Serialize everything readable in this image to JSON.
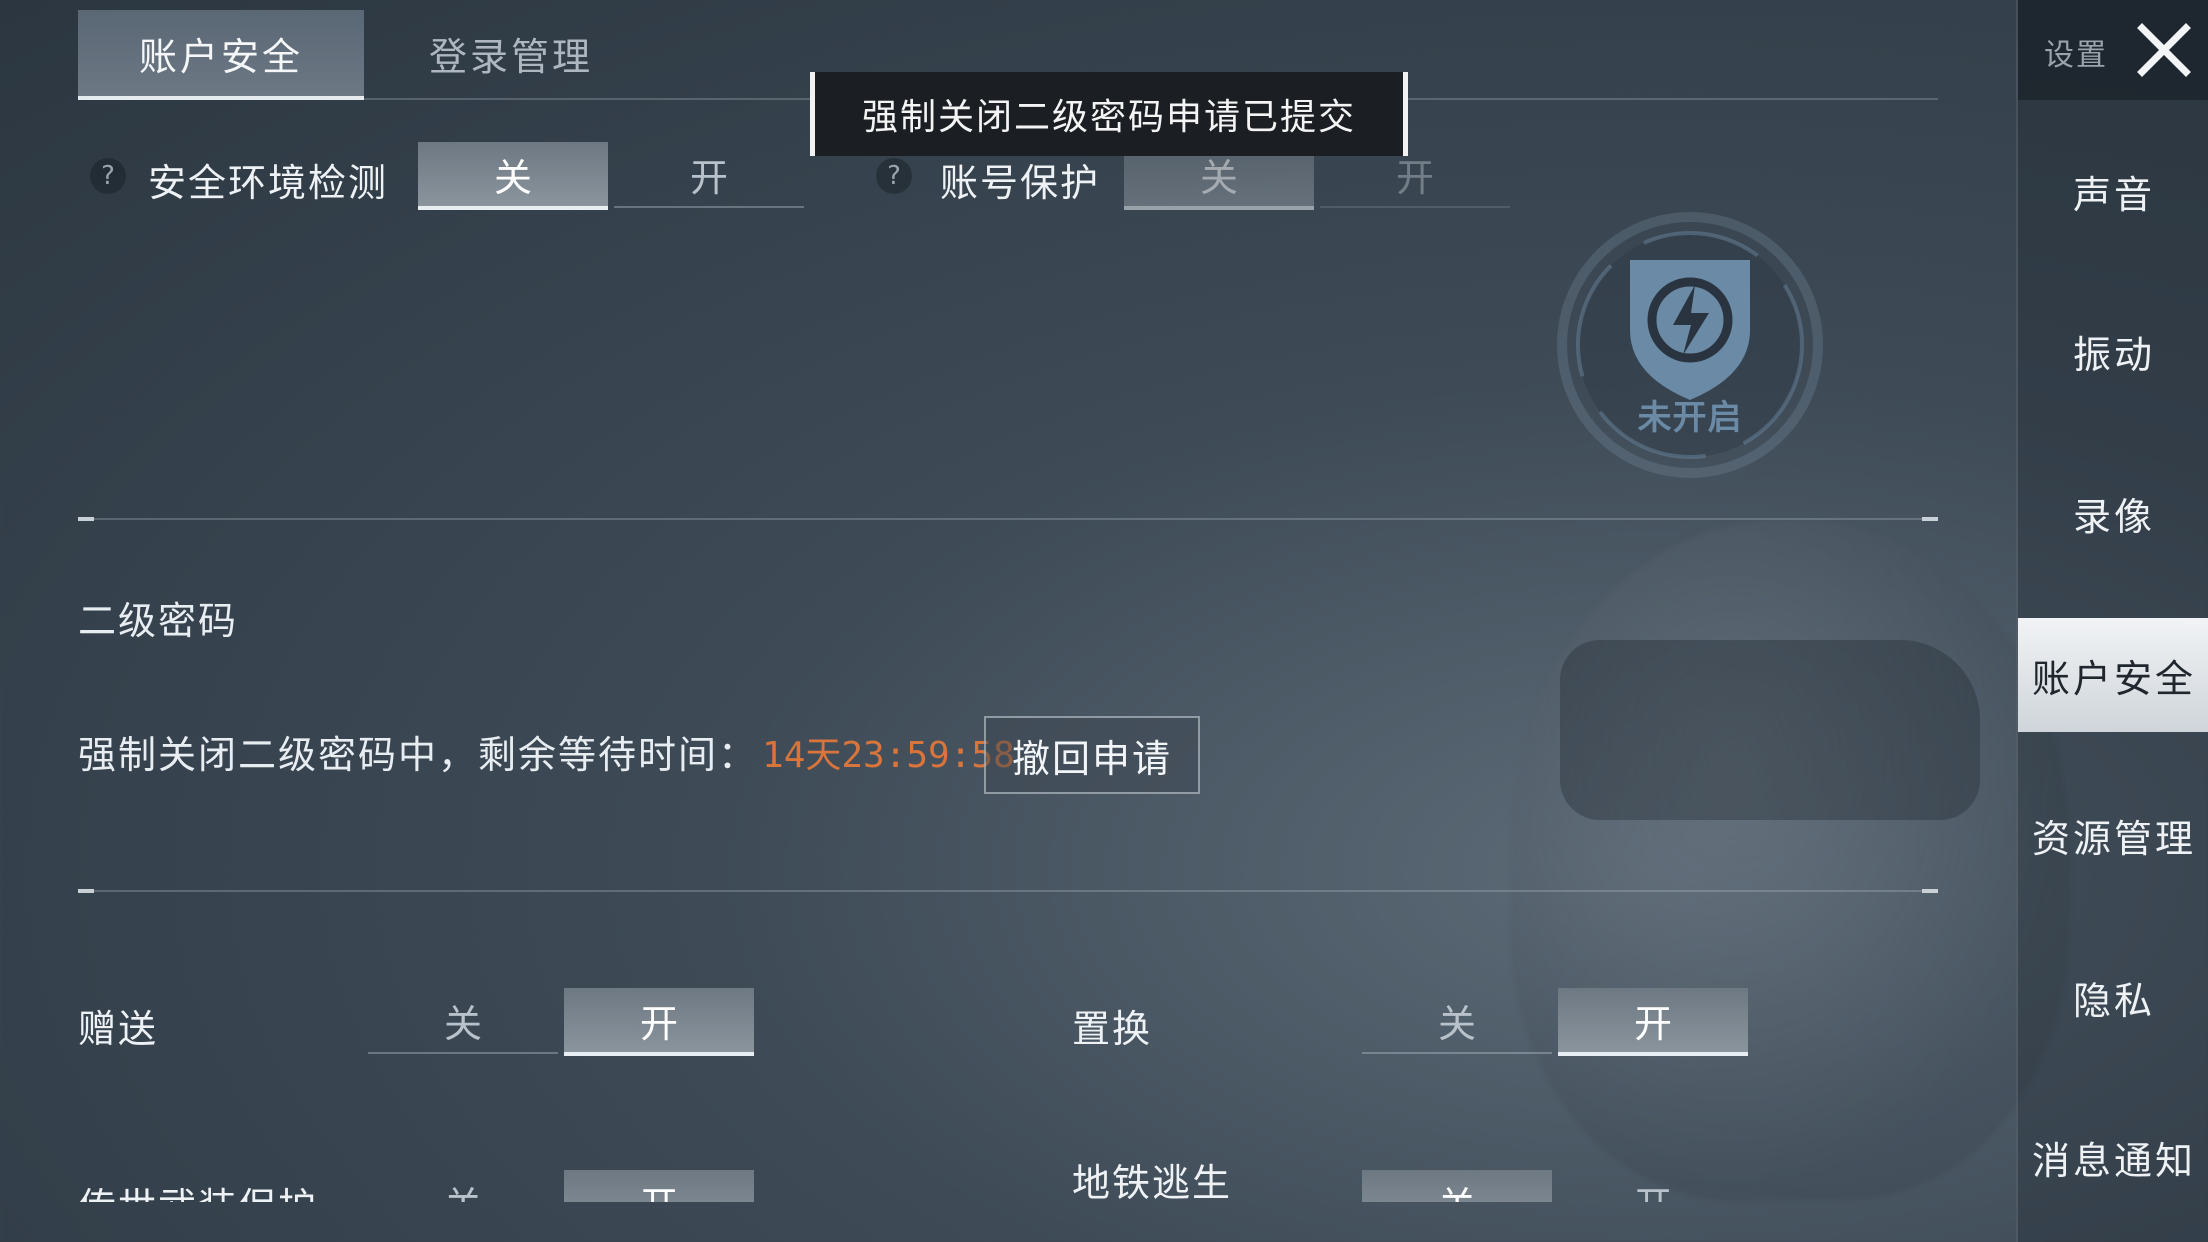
{
  "tabs": [
    {
      "label": "账户安全",
      "active": true
    },
    {
      "label": "登录管理",
      "active": false
    }
  ],
  "toast": "强制关闭二级密码申请已提交",
  "security_check": {
    "help": "?",
    "label": "安全环境检测",
    "off": "关",
    "on": "开",
    "selected": "off"
  },
  "account_protect": {
    "help": "?",
    "label": "账号保护",
    "off": "关",
    "on": "开",
    "selected": "off"
  },
  "badge": {
    "status": "未开启",
    "icon": "shield-lightning-icon"
  },
  "second_password": {
    "title": "二级密码",
    "status_text": "强制关闭二级密码中，剩余等待时间：",
    "countdown": "14天23:59:58",
    "withdraw_button": "撤回申请"
  },
  "gift": {
    "label": "赠送",
    "off": "关",
    "on": "开",
    "selected": "on"
  },
  "exchange": {
    "label": "置换",
    "off": "关",
    "on": "开",
    "selected": "on"
  },
  "legendary_protect": {
    "label": "传世武装保护",
    "off": "关",
    "on": "开",
    "selected": "on"
  },
  "metro_escape": {
    "label": "地铁逃生",
    "off": "关",
    "on": "开",
    "selected": "off"
  },
  "sidebar": {
    "title": "设置",
    "close_icon": "close-icon",
    "items": [
      {
        "label": "声音"
      },
      {
        "label": "振动"
      },
      {
        "label": "录像"
      },
      {
        "label": "账户安全",
        "active": true
      },
      {
        "label": "资源管理"
      },
      {
        "label": "隐私"
      },
      {
        "label": "消息通知"
      }
    ]
  },
  "colors": {
    "countdown": "#d9743a",
    "badge": "#6a8aa6"
  }
}
